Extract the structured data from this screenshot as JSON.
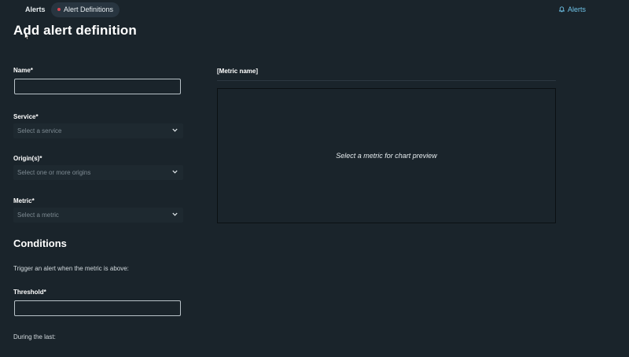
{
  "nav": {
    "tabs": [
      {
        "label": "Alerts"
      },
      {
        "label": "Alert Definitions",
        "active": true
      }
    ],
    "right_link": {
      "label": "Alerts",
      "icon": "bell-icon"
    },
    "active_dot_color": "#d64550",
    "link_color": "#6fc3e8"
  },
  "page": {
    "title": "Add alert definition"
  },
  "form": {
    "name": {
      "label": "Name*",
      "value": ""
    },
    "service": {
      "label": "Service*",
      "placeholder": "Select a service",
      "icon": "chevron-down-icon"
    },
    "origins": {
      "label": "Origin(s)*",
      "placeholder": "Select one or more origins",
      "icon": "chevron-down-icon"
    },
    "metric": {
      "label": "Metric*",
      "placeholder": "Select a metric",
      "icon": "chevron-down-icon"
    }
  },
  "conditions": {
    "title": "Conditions",
    "description": "Trigger an alert when the metric is above:",
    "threshold": {
      "label": "Threshold*",
      "value": ""
    },
    "during_label": "During the last:"
  },
  "preview": {
    "metric_name": "[Metric name]",
    "placeholder": "Select a metric for chart preview"
  }
}
